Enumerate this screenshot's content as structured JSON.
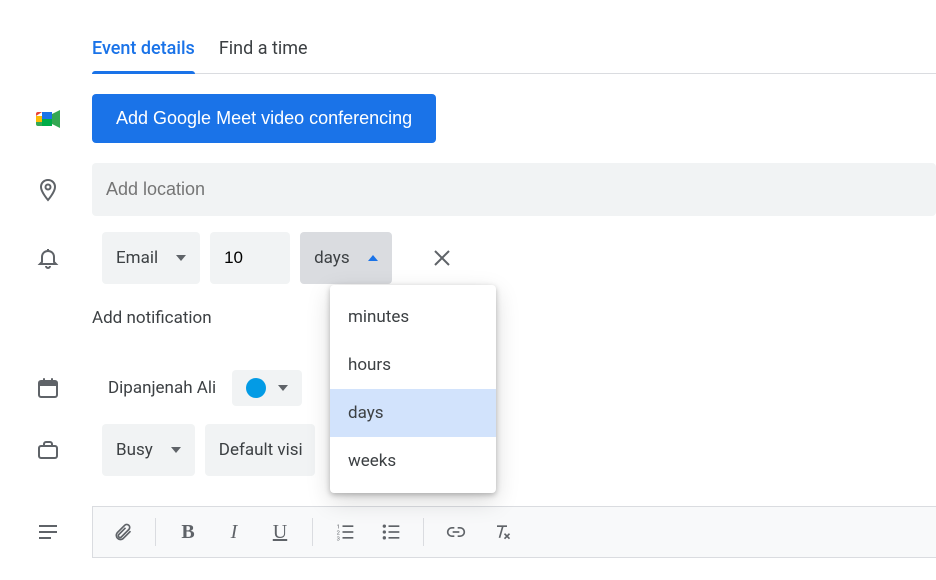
{
  "tabs": {
    "details": "Event details",
    "find_time": "Find a time"
  },
  "meet_button": "Add Google Meet video conferencing",
  "location": {
    "placeholder": "Add location"
  },
  "notification": {
    "method": "Email",
    "value": "10",
    "unit": "days",
    "add_label": "Add notification",
    "unit_options": {
      "minutes": "minutes",
      "hours": "hours",
      "days": "days",
      "weeks": "weeks"
    }
  },
  "calendar": {
    "owner": "Dipanjenah Ali"
  },
  "availability": {
    "status": "Busy",
    "visibility_truncated": "Default visi"
  }
}
